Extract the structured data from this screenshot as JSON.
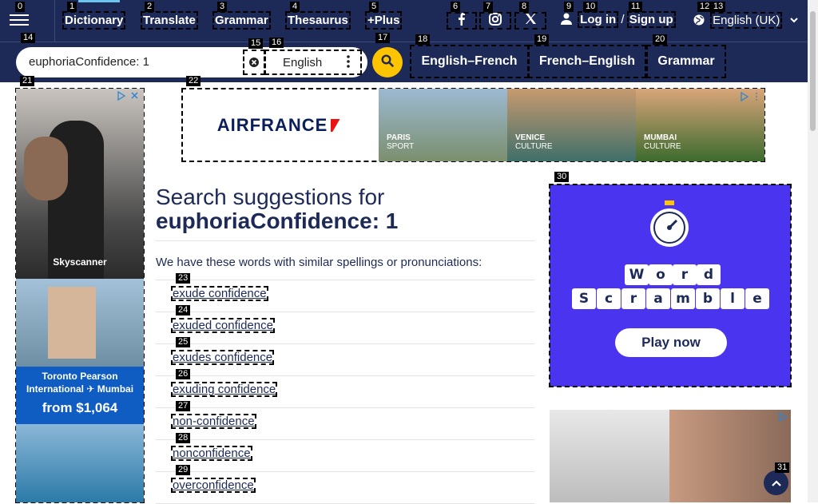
{
  "nav": {
    "items": [
      "Dictionary",
      "Translate",
      "Grammar",
      "Thesaurus",
      "+Plus"
    ],
    "login": "Log in",
    "slash": "/",
    "signup": "Sign up",
    "language": "English (UK)"
  },
  "search": {
    "value": "euphoriaConfidence: 1",
    "lang": "English"
  },
  "quicklinks": [
    "English–French",
    "French–English",
    "Grammar"
  ],
  "main": {
    "heading_prefix": "Search suggestions for",
    "heading_term": "euphoriaConfidence: 1",
    "intro": "We have these words with similar spellings or pronunciations:",
    "suggestions": [
      "exude confidence",
      "exuded confidence",
      "exudes confidence",
      "exuding confidence",
      "non-confidence",
      "nonconfidence",
      "overconfidence"
    ]
  },
  "ads": {
    "banner_brand": "AIRFRANCE",
    "banner_cities": [
      {
        "city": "PARIS",
        "tag": "SPORT"
      },
      {
        "city": "VENICE",
        "tag": "CULTURE"
      },
      {
        "city": "MUMBAI",
        "tag": "CULTURE"
      }
    ],
    "left_brand": "Skyscanner",
    "left_route": "Toronto Pearson International ✈ Mumbai",
    "left_price": "from $1,064",
    "right_word1": [
      "W",
      "o",
      "r",
      "d"
    ],
    "right_word2": [
      "S",
      "c",
      "r",
      "a",
      "m",
      "b",
      "l",
      "e"
    ],
    "right_cta": "Play now"
  },
  "labels": [
    "0",
    "1",
    "2",
    "3",
    "4",
    "5",
    "6",
    "7",
    "8",
    "9",
    "10",
    "11",
    "12",
    "13",
    "14",
    "15",
    "16",
    "17",
    "18",
    "19",
    "20",
    "21",
    "22",
    "23",
    "24",
    "25",
    "26",
    "27",
    "28",
    "29",
    "30",
    "31"
  ],
  "colors": {
    "brand": "#1d2a57",
    "accent": "#fec400",
    "scramble": "#4a34f0"
  },
  "icons": [
    "menu-icon",
    "facebook-icon",
    "instagram-icon",
    "x-icon",
    "user-icon",
    "globe-icon",
    "chevron-down-icon",
    "clear-icon",
    "more-vert-icon",
    "search-icon",
    "arrow-up-icon"
  ]
}
